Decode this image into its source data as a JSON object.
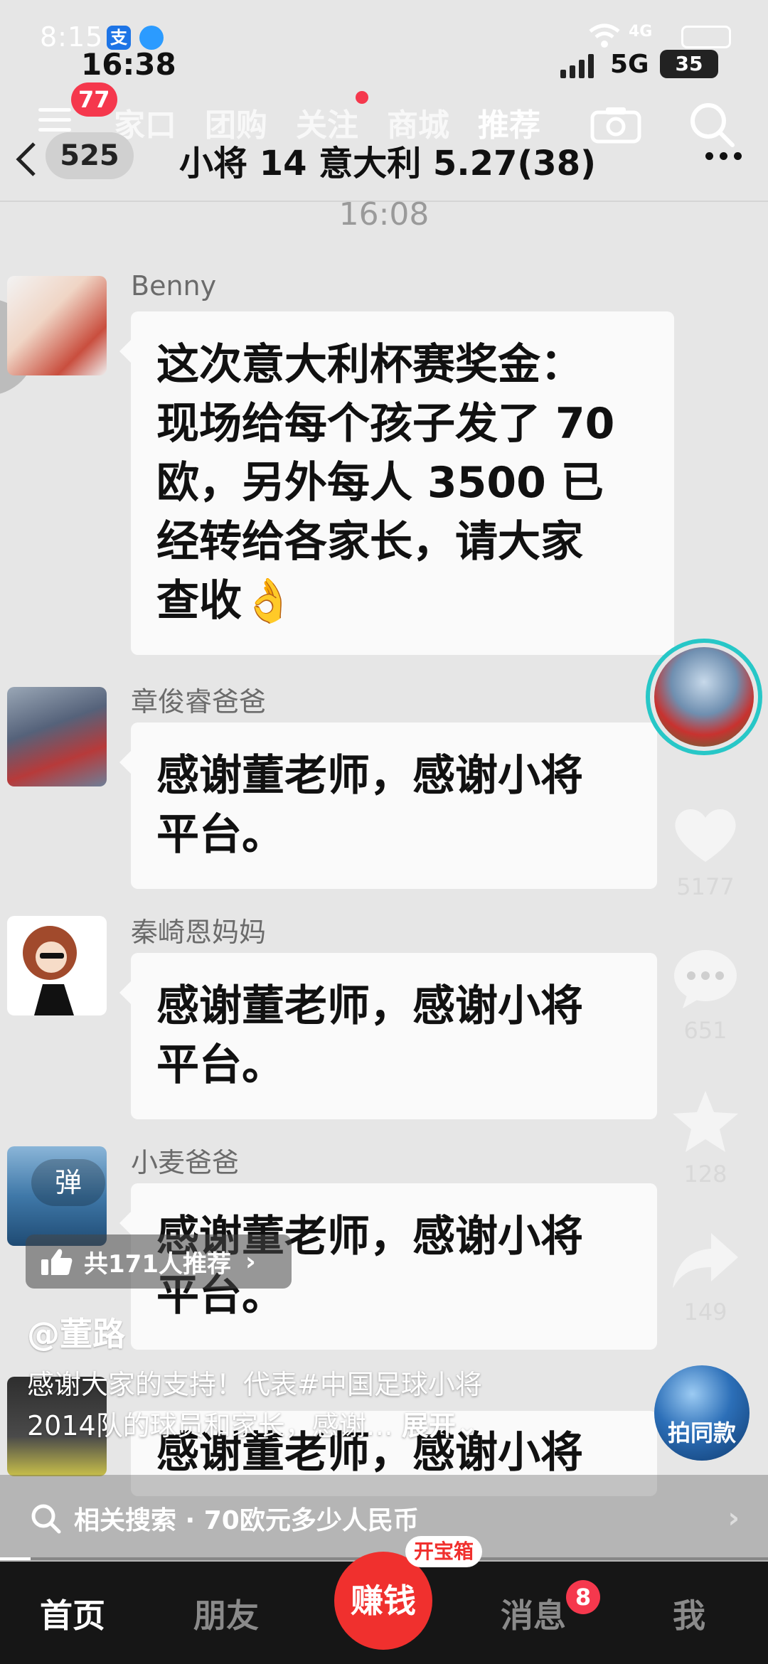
{
  "status_bar": {
    "time_overlay": "8:15",
    "app_icon_1": "支",
    "time": "16:38",
    "network": "5G",
    "battery": "35"
  },
  "top_nav": {
    "menu_badge": "77",
    "tabs": [
      "家口",
      "团购",
      "关注",
      "商城",
      "推荐"
    ],
    "active_tab": "推荐"
  },
  "chat_header": {
    "unread_count": "525",
    "title": "小将 14 意大利 5.27(38)"
  },
  "chat_time": "16:08",
  "messages": [
    {
      "sender": "Benny",
      "text_lines": [
        "这次意大利杯赛奖金：",
        "现场给每个孩子发了 70",
        "欧，另外每人 3500 已",
        "经转给各家长，请大家",
        "查收👌"
      ]
    },
    {
      "sender": "章俊睿爸爸",
      "text_lines": [
        "感谢董老师，感谢小将",
        "平台。"
      ]
    },
    {
      "sender": "秦崎恩妈妈",
      "text_lines": [
        "感谢董老师，感谢小将",
        "平台。"
      ]
    },
    {
      "sender": "小麦爸爸",
      "text_lines": [
        "感谢董老师，感谢小将",
        "平台。"
      ]
    },
    {
      "sender": "",
      "text_lines": [
        "感谢董老师，感谢小将"
      ]
    }
  ],
  "actions": {
    "likes": "5177",
    "comments": "651",
    "favorites": "128",
    "shares": "149"
  },
  "danmu_label": "弹",
  "recommend_text": "共171人推荐",
  "author": "@董路",
  "caption_line1": "感谢大家的支持！代表#中国足球小将",
  "caption_line2": "2014队的球员和家长，感谢…",
  "caption_more": "展开",
  "same_style_label": "拍同款",
  "related_search": "相关搜索 · 70欧元多少人民币",
  "progress": 0.04,
  "bottom_tabs": {
    "home": "首页",
    "friends": "朋友",
    "earn": "赚钱",
    "treasure": "开宝箱",
    "messages": "消息",
    "messages_badge": "8",
    "me": "我"
  },
  "colors": {
    "accent_red": "#f5384d",
    "ring_teal": "#27c7c7",
    "tabbar_bg": "#161616"
  }
}
